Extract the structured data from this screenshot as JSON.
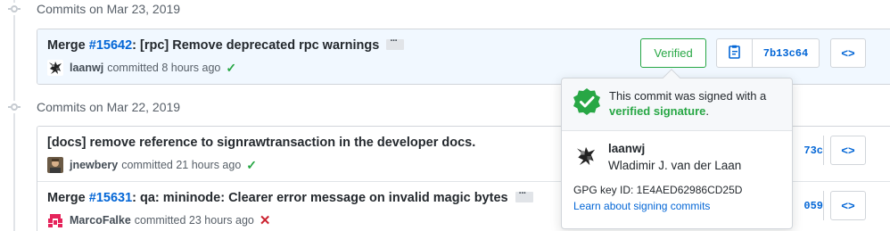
{
  "groups": [
    {
      "title": "Commits on Mar 23, 2019",
      "commits": [
        {
          "title_prefix": "Merge ",
          "issue": "#15642",
          "title_rest": ": [rpc] Remove deprecated rpc warnings",
          "author": "laanwj",
          "time": "committed 8 hours ago",
          "status": "✓",
          "verified": "Verified",
          "sha": "7b13c64",
          "browse": "<>"
        }
      ]
    },
    {
      "title": "Commits on Mar 22, 2019",
      "commits": [
        {
          "title": "[docs] remove reference to signrawtransaction in the developer docs.",
          "author": "jnewbery",
          "time": "committed 21 hours ago",
          "status": "✓",
          "sha_partial": "73c",
          "browse": "<>"
        },
        {
          "title_prefix": "Merge ",
          "issue": "#15631",
          "title_rest": ": qa: mininode: Clearer error message on invalid magic bytes",
          "author": "MarcoFalke",
          "time": "committed 23 hours ago",
          "status": "✕",
          "sha_partial": "059",
          "browse": "<>"
        }
      ]
    }
  ],
  "popover": {
    "msg_prefix": "This commit was signed with a",
    "msg_verified": "verified signature",
    "msg_suffix": ".",
    "login": "laanwj",
    "fullname": "Wladimir J. van der Laan",
    "gpg": "GPG key ID: 1E4AED62986CD25D",
    "learn": "Learn about signing commits"
  },
  "colors": {
    "verified_green": "#28a745",
    "link_blue": "#0366d6",
    "fail_red": "#cb2431",
    "highlight_bg": "#f1f8ff"
  },
  "icons": {
    "clipboard": "clipboard-icon",
    "browse": "code-icon",
    "shield": "verified-shield-icon",
    "commit": "git-commit-icon"
  }
}
